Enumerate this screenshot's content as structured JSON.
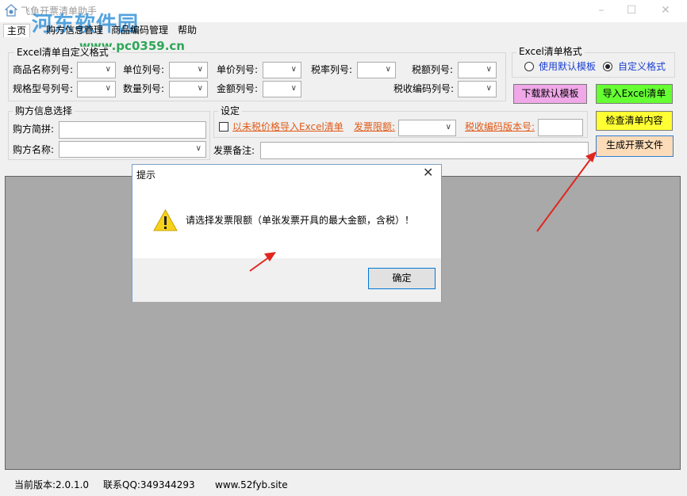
{
  "window": {
    "title": "飞鱼开票清单助手",
    "minimize_icon": "minimize-icon",
    "maximize_icon": "maximize-icon",
    "close_icon": "close-icon",
    "watermark_text": "河东软件园",
    "watermark_url": "www.pc0359.cn"
  },
  "menu": [
    "主页",
    "购方信息管理",
    "商品编码管理",
    "帮助"
  ],
  "excel_custom": {
    "title": "Excel清单自定义格式",
    "labels": {
      "name_col": "商品名称列号:",
      "unit_col": "单位列号:",
      "price_col": "单价列号:",
      "rate_col": "税率列号:",
      "tax_col": "税额列号:",
      "spec_col": "规格型号列号:",
      "qty_col": "数量列号:",
      "amount_col": "金额列号:",
      "taxcode_col": "税收编码列号:"
    }
  },
  "excel_format": {
    "title": "Excel清单格式",
    "options": [
      "使用默认模板",
      "自定义格式"
    ],
    "selected": "自定义格式"
  },
  "buttons": {
    "download_template": "下载默认模板",
    "import_excel": "导入Excel清单",
    "check_list": "检查清单内容",
    "generate_file": "生成开票文件"
  },
  "colors": {
    "download_template": "#f0a8e8",
    "import_excel": "#66ff33",
    "check_list": "#ffff33",
    "generate_file": "#fcdcb8",
    "link": "#e05a17"
  },
  "buyer": {
    "title": "购方信息选择",
    "abbr_label": "购方简拼:",
    "name_label": "购方名称:"
  },
  "settings": {
    "title": "设定",
    "import_without_tax": "以未税价格导入Excel清单",
    "invoice_limit": "发票限额:",
    "taxcode_version": "税收编码版本号:"
  },
  "remark": {
    "label": "发票备注:"
  },
  "status": {
    "version": "当前版本:2.0.1.0",
    "qq": "联系QQ:349344293",
    "site": "www.52fyb.site"
  },
  "dialog": {
    "title": "提示",
    "message": "请选择发票限额（单张发票开具的最大金额，含税）！",
    "ok": "确定",
    "icon": "warning-icon"
  }
}
